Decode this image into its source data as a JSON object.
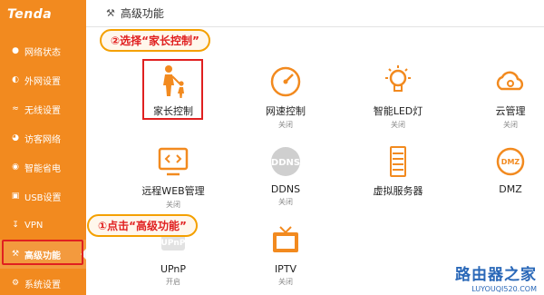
{
  "logo": "Tenda",
  "header": {
    "title": "高级功能"
  },
  "sidebar": {
    "items": [
      {
        "label": "网络状态",
        "icon": "network-status-icon"
      },
      {
        "label": "外网设置",
        "icon": "globe-icon"
      },
      {
        "label": "无线设置",
        "icon": "wifi-icon"
      },
      {
        "label": "访客网络",
        "icon": "guest-icon"
      },
      {
        "label": "智能省电",
        "icon": "power-save-icon"
      },
      {
        "label": "USB设置",
        "icon": "usb-icon"
      },
      {
        "label": "VPN",
        "icon": "vpn-icon"
      },
      {
        "label": "高级功能",
        "icon": "wrench-icon",
        "active": true
      },
      {
        "label": "系统设置",
        "icon": "settings-icon"
      }
    ]
  },
  "tiles": [
    {
      "name": "家长控制",
      "status": "",
      "icon": "parental-control-icon"
    },
    {
      "name": "网速控制",
      "status": "关闭",
      "icon": "speedometer-icon"
    },
    {
      "name": "智能LED灯",
      "status": "关闭",
      "icon": "led-bulb-icon"
    },
    {
      "name": "云管理",
      "status": "关闭",
      "icon": "cloud-gear-icon"
    },
    {
      "name": "远程WEB管理",
      "status": "关闭",
      "icon": "remote-monitor-icon"
    },
    {
      "name": "DDNS",
      "status": "关闭",
      "icon": "ddns-icon"
    },
    {
      "name": "虚拟服务器",
      "status": "",
      "icon": "server-icon"
    },
    {
      "name": "DMZ",
      "status": "",
      "icon": "dmz-icon"
    },
    {
      "name": "UPnP",
      "status": "开启",
      "icon": "upnp-icon"
    },
    {
      "name": "IPTV",
      "status": "关闭",
      "icon": "tv-icon"
    }
  ],
  "annotations": {
    "step1": "①点击“高级功能”",
    "step2": "②选择“家长控制”"
  },
  "watermark": {
    "cn": "路由器之家",
    "en": "LUYOUQI520.COM"
  },
  "colors": {
    "accent": "#f28a1f",
    "highlight": "#e02020",
    "callout_border": "#f4a000"
  }
}
